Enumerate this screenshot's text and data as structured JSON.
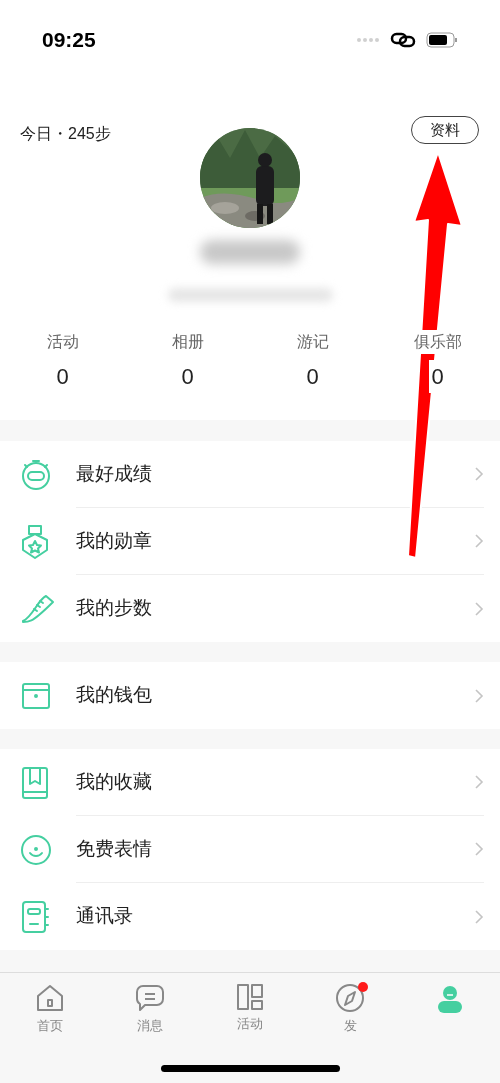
{
  "status_bar": {
    "time": "09:25"
  },
  "header": {
    "steps": "今日・245步",
    "profile_button": "资料"
  },
  "stats": [
    {
      "label": "活动",
      "value": "0"
    },
    {
      "label": "相册",
      "value": "0"
    },
    {
      "label": "游记",
      "value": "0"
    },
    {
      "label": "俱乐部",
      "value": "0"
    }
  ],
  "menu_groups": [
    [
      {
        "kind": "stopwatch",
        "label": "最好成绩"
      },
      {
        "kind": "medal",
        "label": "我的勋章"
      },
      {
        "kind": "shoe",
        "label": "我的步数"
      }
    ],
    [
      {
        "kind": "wallet",
        "label": "我的钱包"
      }
    ],
    [
      {
        "kind": "bookmark",
        "label": "我的收藏"
      },
      {
        "kind": "smile",
        "label": "免费表情"
      },
      {
        "kind": "contacts",
        "label": "通讯录"
      }
    ]
  ],
  "tab_bar": [
    {
      "kind": "home",
      "label": "首页",
      "selected": false,
      "badge": false
    },
    {
      "kind": "chat",
      "label": "消息",
      "selected": false,
      "badge": false
    },
    {
      "kind": "grid",
      "label": "活动",
      "selected": false,
      "badge": false
    },
    {
      "kind": "compass",
      "label": "发",
      "selected": false,
      "badge": true
    },
    {
      "kind": "person",
      "selected": true,
      "badge": false
    }
  ]
}
